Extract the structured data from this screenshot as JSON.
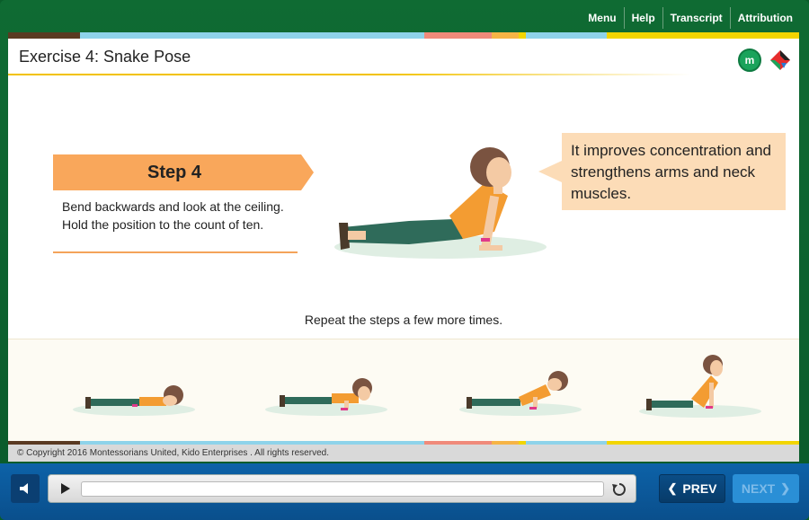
{
  "topnav": {
    "items": [
      {
        "label": "Menu"
      },
      {
        "label": "Help"
      },
      {
        "label": "Transcript"
      },
      {
        "label": "Attribution"
      }
    ]
  },
  "slide": {
    "title": "Exercise 4: Snake Pose",
    "logo_mu_text": "m",
    "step": {
      "label": "Step 4",
      "text": "Bend backwards and look at the ceiling. Hold the position to the count of ten."
    },
    "bubble_text": "It improves concentration and strengthens arms and neck muscles.",
    "repeat_text": "Repeat the steps a few more times.",
    "copyright": "© Copyright 2016  Montessorians United, Kido Enterprises . All rights reserved."
  },
  "player": {
    "prev_label": "PREV",
    "next_label": "NEXT",
    "progress": 0
  },
  "colors": {
    "frame": "#0f6b33",
    "banner": "#f9a75b",
    "bubble": "#fcdcb7",
    "shirt": "#f39c32",
    "pants": "#2f6b5a",
    "skin": "#f4caa4",
    "hair": "#7a5340",
    "mat": "#dfeee3",
    "control_bar": "#0d62a8"
  }
}
